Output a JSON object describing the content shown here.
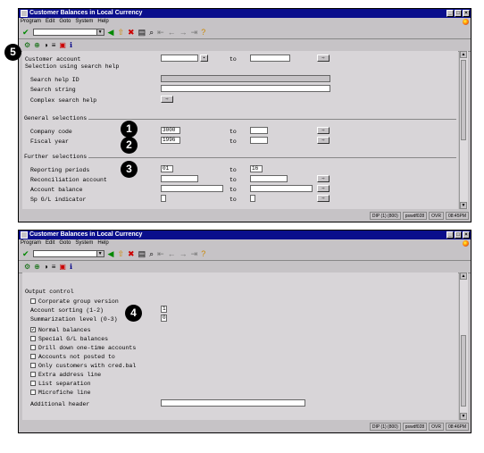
{
  "window_title": "Customer Balances in Local Currency",
  "menu": [
    "Program",
    "Edit",
    "Goto",
    "System",
    "Help"
  ],
  "toolbar_icons": [
    "check-icon",
    "back-icon",
    "exit-icon",
    "cancel-icon",
    "print-icon",
    "find-icon",
    "first-page-icon",
    "prev-page-icon",
    "next-page-icon",
    "last-page-icon",
    "help-icon"
  ],
  "callouts": {
    "c1": "1",
    "c2": "2",
    "c3": "3",
    "c4": "4",
    "c5": "5"
  },
  "status": {
    "system": "DIP (1) (800)",
    "server": "pswdf028",
    "mode": "OVR",
    "time1": "08:45PM",
    "time2": "08:46PM"
  },
  "screen1": {
    "to_label": "to",
    "customer_account": "Customer account",
    "selection_search_help": "Selection using search help",
    "search_help_id": "Search help ID",
    "search_string": "Search string",
    "complex_search_help": "Complex search help",
    "general_selections": "General selections",
    "company_code": "Company code",
    "company_code_value": "3000",
    "fiscal_year": "Fiscal year",
    "fiscal_year_value": "1996",
    "further_selections": "Further selections",
    "reporting_periods": "Reporting periods",
    "reporting_from": "01",
    "reporting_to": "16",
    "reconciliation_account": "Reconciliation account",
    "account_balance": "Account balance",
    "sp_gl_indicator": "Sp G/L indicator"
  },
  "screen2": {
    "output_control": "Output control",
    "corporate_group_version": "Corporate group version",
    "account_sorting": "Account sorting (1-2)",
    "account_sorting_value": "1",
    "summarization_level": "Summarization level (0-3)",
    "summarization_value": "0",
    "checkboxes": [
      {
        "label": "Normal balances",
        "checked": true
      },
      {
        "label": "Special G/L balances",
        "checked": false
      },
      {
        "label": "Drill down one-time accounts",
        "checked": false
      },
      {
        "label": "Accounts not posted to",
        "checked": false
      },
      {
        "label": "Only customers with cred.bal",
        "checked": false
      },
      {
        "label": "Extra address line",
        "checked": false
      },
      {
        "label": "List separation",
        "checked": false
      },
      {
        "label": "Microfiche line",
        "checked": false
      }
    ],
    "additional_header": "Additional header"
  }
}
